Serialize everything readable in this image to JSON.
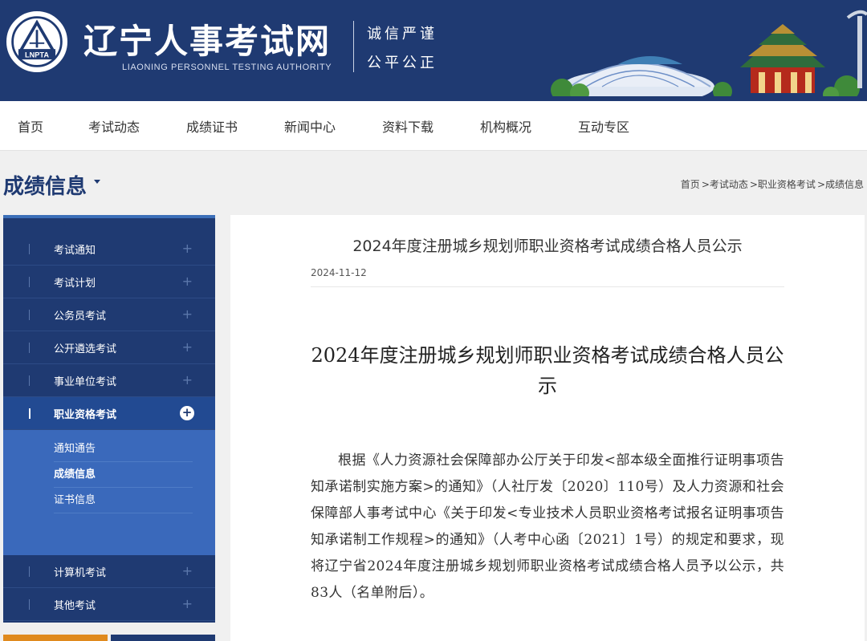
{
  "header": {
    "logo_text": "LNPTA",
    "site_title": "辽宁人事考试网",
    "site_subtitle": "LIAONING PERSONNEL TESTING AUTHORITY",
    "motto_line1": "诚信严谨",
    "motto_line2": "公平公正",
    "colors": {
      "header_bg": "#1f3a72"
    }
  },
  "nav": {
    "items": [
      "首页",
      "考试动态",
      "成绩证书",
      "新闻中心",
      "资料下载",
      "机构概况",
      "互动专区"
    ]
  },
  "section": {
    "title": "成绩信息",
    "breadcrumb": [
      "首页",
      ">考试动态",
      ">职业资格考试",
      ">成绩信息"
    ]
  },
  "sidebar": {
    "items": [
      {
        "label": "考试通知",
        "icon": "plus-icon"
      },
      {
        "label": "考试计划",
        "icon": "plus-icon"
      },
      {
        "label": "公务员考试",
        "icon": "plus-icon"
      },
      {
        "label": "公开遴选考试",
        "icon": "plus-icon"
      },
      {
        "label": "事业单位考试",
        "icon": "plus-icon"
      },
      {
        "label": "职业资格考试",
        "icon": "plus-icon",
        "active": true
      },
      {
        "label": "计算机考试",
        "icon": "plus-icon"
      },
      {
        "label": "其他考试",
        "icon": "plus-icon"
      }
    ],
    "submenu": [
      "通知通告",
      "成绩信息",
      "证书信息"
    ]
  },
  "article": {
    "title": "2024年度注册城乡规划师职业资格考试成绩合格人员公示",
    "date": "2024-11-12",
    "doc_title": "2024年度注册城乡规划师职业资格考试成绩合格人员公示",
    "body": "根据《人力资源社会保障部办公厅关于印发<部本级全面推行证明事项告知承诺制实施方案>的通知》（人社厅发〔2020〕110号）及人力资源和社会保障部人事考试中心《关于印发<专业技术人员职业资格考试报名证明事项告知承诺制工作规程>的通知》（人考中心函〔2021〕1号）的规定和要求，现将辽宁省2024年度注册城乡规划师职业资格考试成绩合格人员予以公示，共83人（名单附后）。"
  }
}
